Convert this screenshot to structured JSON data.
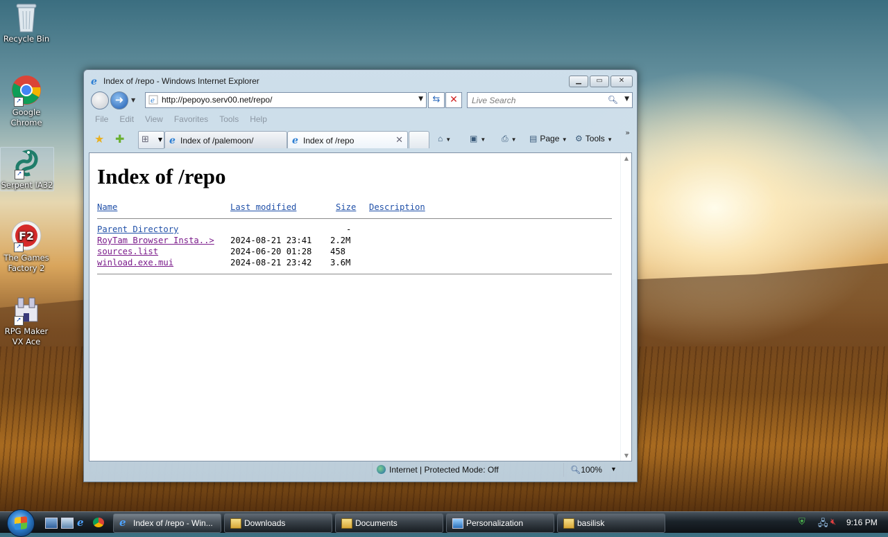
{
  "desktop": {
    "icons": [
      {
        "label": "Recycle Bin"
      },
      {
        "label": "Google Chrome"
      },
      {
        "label": "Serpent IA32"
      },
      {
        "label": "The Games Factory 2"
      },
      {
        "label": "RPG Maker VX Ace"
      }
    ]
  },
  "window": {
    "title": "Index of /repo - Windows Internet Explorer",
    "address": "http://pepoyo.serv00.net/repo/",
    "search_placeholder": "Live Search",
    "menu": [
      "File",
      "Edit",
      "View",
      "Favorites",
      "Tools",
      "Help"
    ],
    "tabs": [
      {
        "label": "Index of /palemoon/",
        "active": false
      },
      {
        "label": "Index of /repo",
        "active": true
      }
    ],
    "commands": {
      "page": "Page",
      "tools": "Tools"
    }
  },
  "page": {
    "heading": "Index of /repo",
    "columns": {
      "name": "Name",
      "modified": "Last modified",
      "size": "Size",
      "description": "Description"
    },
    "parent": {
      "name": "Parent Directory",
      "size": "-"
    },
    "files": [
      {
        "name": "RoyTam Browser Insta..>",
        "modified": "2024-08-21 23:41",
        "size": "2.2M"
      },
      {
        "name": "sources.list",
        "modified": "2024-06-20 01:28",
        "size": "458"
      },
      {
        "name": "winload.exe.mui",
        "modified": "2024-08-21 23:42",
        "size": "3.6M"
      }
    ]
  },
  "status": {
    "zone": "Internet | Protected Mode: Off",
    "zoom": "100%"
  },
  "taskbar": {
    "buttons": [
      {
        "label": "Index of /repo - Win..."
      },
      {
        "label": "Downloads"
      },
      {
        "label": "Documents"
      },
      {
        "label": "Personalization"
      },
      {
        "label": "basilisk"
      }
    ],
    "clock": "9:16 PM"
  }
}
